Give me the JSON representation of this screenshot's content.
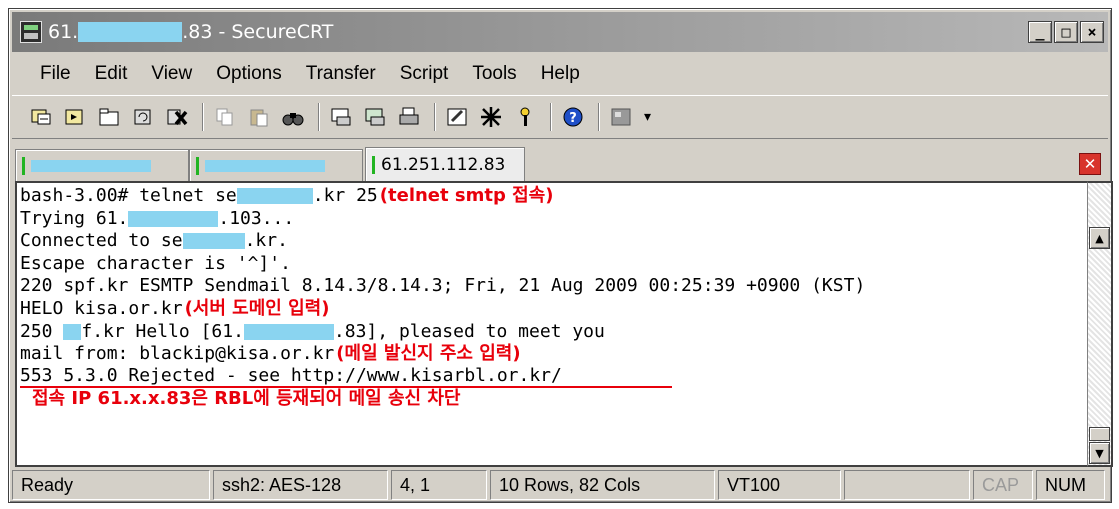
{
  "window": {
    "title_prefix": "61.",
    "title_suffix": ".83 - SecureCRT",
    "controls": {
      "minimize": "_",
      "maximize": "□",
      "close": "×"
    }
  },
  "menu": [
    "File",
    "Edit",
    "View",
    "Options",
    "Transfer",
    "Script",
    "Tools",
    "Help"
  ],
  "toolbar": {
    "icons": [
      "connect-icon",
      "quick-connect-icon",
      "connect-tab-icon",
      "reconnect-icon",
      "disconnect-icon",
      "copy-icon",
      "paste-icon",
      "find-icon",
      "print-screen-icon",
      "print-selection-icon",
      "print-icon",
      "session-options-icon",
      "global-options-icon",
      "keymap-icon",
      "help-icon",
      "sftp-icon"
    ],
    "more": "▾"
  },
  "tabs": [
    {
      "label": ""
    },
    {
      "label": ""
    },
    {
      "label": "61.251.112.83",
      "active": true
    }
  ],
  "terminal": {
    "lines": {
      "l1_pre": "bash-3.00# telnet se",
      "l1_post": ".kr 25",
      "l1_note": "(telnet smtp 접속)",
      "l2_pre": "Trying 61.",
      "l2_post": ".103...",
      "l3_pre": "Connected to se",
      "l3_post": ".kr.",
      "l4": "Escape character is '^]'.",
      "l5": "220 spf.kr ESMTP Sendmail 8.14.3/8.14.3; Fri, 21 Aug 2009 00:25:39 +0900 (KST)",
      "l6": "HELO kisa.or.kr",
      "l6_note": "(서버 도메인 입력)",
      "l7_pre": "250 ",
      "l7_mid": "f.kr Hello [61.",
      "l7_post": ".83], pleased to meet you",
      "l8": "mail from: blackip@kisa.or.kr",
      "l8_note": "(메일 발신지 주소 입력)",
      "l9": "553 5.3.0 Rejected - see http://www.kisarbl.or.kr/",
      "caption": "접속 IP 61.x.x.83은 RBL에 등재되어 메일 송신 차단"
    }
  },
  "status": {
    "ready": "Ready",
    "cipher": "ssh2: AES-128",
    "position": "4,  1",
    "size": "10 Rows,  82 Cols",
    "emulation": "VT100",
    "cap": "CAP",
    "num": "NUM"
  },
  "colors": {
    "annotation": "#e8000b",
    "redaction": "#8ad4f0",
    "chrome": "#d4d0c8"
  }
}
